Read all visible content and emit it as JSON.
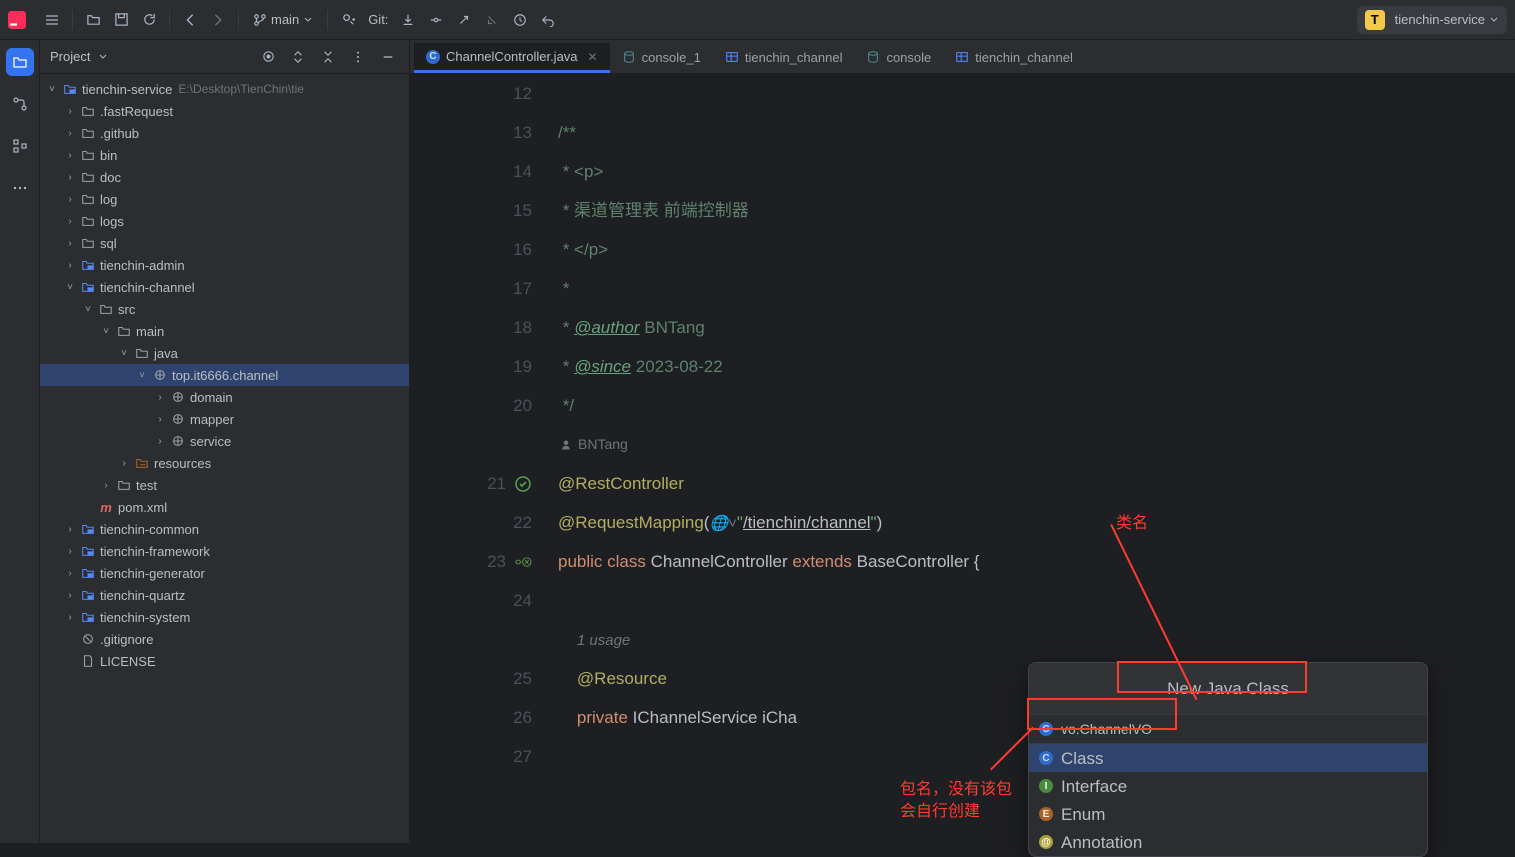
{
  "toolbar": {
    "branch": "main",
    "git_label": "Git:",
    "project": "tienchin-service",
    "project_badge": "T"
  },
  "project_panel": {
    "title": "Project",
    "root": {
      "name": "tienchin-service",
      "path": "E:\\Desktop\\TienChin\\tie"
    },
    "items": [
      {
        "indent": 1,
        "chev": ">",
        "type": "folder",
        "name": ".fastRequest"
      },
      {
        "indent": 1,
        "chev": ">",
        "type": "folder",
        "name": ".github"
      },
      {
        "indent": 1,
        "chev": ">",
        "type": "folder",
        "name": "bin"
      },
      {
        "indent": 1,
        "chev": ">",
        "type": "folder",
        "name": "doc"
      },
      {
        "indent": 1,
        "chev": ">",
        "type": "folder",
        "name": "log"
      },
      {
        "indent": 1,
        "chev": ">",
        "type": "folder",
        "name": "logs"
      },
      {
        "indent": 1,
        "chev": ">",
        "type": "folder",
        "name": "sql"
      },
      {
        "indent": 1,
        "chev": ">",
        "type": "module",
        "name": "tienchin-admin"
      },
      {
        "indent": 1,
        "chev": "v",
        "type": "module",
        "name": "tienchin-channel"
      },
      {
        "indent": 2,
        "chev": "v",
        "type": "folder",
        "name": "src"
      },
      {
        "indent": 3,
        "chev": "v",
        "type": "folder",
        "name": "main"
      },
      {
        "indent": 4,
        "chev": "v",
        "type": "folder",
        "name": "java"
      },
      {
        "indent": 5,
        "chev": "v",
        "type": "package",
        "name": "top.it6666.channel",
        "sel": true
      },
      {
        "indent": 6,
        "chev": ">",
        "type": "package",
        "name": "domain"
      },
      {
        "indent": 6,
        "chev": ">",
        "type": "package",
        "name": "mapper"
      },
      {
        "indent": 6,
        "chev": ">",
        "type": "package",
        "name": "service"
      },
      {
        "indent": 4,
        "chev": ">",
        "type": "resources",
        "name": "resources"
      },
      {
        "indent": 3,
        "chev": ">",
        "type": "folder",
        "name": "test"
      },
      {
        "indent": 2,
        "chev": "",
        "type": "maven",
        "name": "pom.xml"
      },
      {
        "indent": 1,
        "chev": ">",
        "type": "module",
        "name": "tienchin-common"
      },
      {
        "indent": 1,
        "chev": ">",
        "type": "module",
        "name": "tienchin-framework"
      },
      {
        "indent": 1,
        "chev": ">",
        "type": "module",
        "name": "tienchin-generator"
      },
      {
        "indent": 1,
        "chev": ">",
        "type": "module",
        "name": "tienchin-quartz"
      },
      {
        "indent": 1,
        "chev": ">",
        "type": "module",
        "name": "tienchin-system"
      },
      {
        "indent": 1,
        "chev": "",
        "type": "gitignore",
        "name": ".gitignore"
      },
      {
        "indent": 1,
        "chev": "",
        "type": "file",
        "name": "LICENSE"
      }
    ]
  },
  "tabs": [
    {
      "icon": "class",
      "label": "ChannelController.java",
      "active": true,
      "closable": true
    },
    {
      "icon": "db",
      "label": "console_1"
    },
    {
      "icon": "table",
      "label": "tienchin_channel"
    },
    {
      "icon": "db",
      "label": "console"
    },
    {
      "icon": "table",
      "label": "tienchin_channel"
    }
  ],
  "code": {
    "lines": [
      {
        "n": "12",
        "html": ""
      },
      {
        "n": "13",
        "html": "<span class='c-doc'>/**</span>"
      },
      {
        "n": "14",
        "html": "<span class='c-doc'> * &lt;p&gt;</span>"
      },
      {
        "n": "15",
        "html": "<span class='c-doc'> * 渠道管理表 前端控制器</span>"
      },
      {
        "n": "16",
        "html": "<span class='c-doc'> * &lt;/p&gt;</span>"
      },
      {
        "n": "17",
        "html": "<span class='c-doc'> *</span>"
      },
      {
        "n": "18",
        "html": "<span class='c-doc'> * </span><span class='c-tag'>@author</span><span class='c-doc'> BNTang</span>"
      },
      {
        "n": "19",
        "html": "<span class='c-doc'> * </span><span class='c-tag'>@since</span><span class='c-doc'> 2023-08-22</span>"
      },
      {
        "n": "20",
        "html": "<span class='c-doc'> */</span>"
      },
      {
        "n": "",
        "author": "BNTang"
      },
      {
        "n": "21",
        "mark": "green-check",
        "html": "<span class='c-ann'>@RestController</span>"
      },
      {
        "n": "22",
        "html": "<span class='c-ann'>@RequestMapping</span>(<span class='c-hint'>🌐˅</span><span class='c-str'>\"</span><span class='c-url'>/tienchin/channel</span><span class='c-str'>\"</span>)"
      },
      {
        "n": "23",
        "mark": "route",
        "html": "<span class='c-key'>public class </span><span class='c-cls'>ChannelController </span><span class='c-key'>extends </span><span class='c-cls'>BaseController {</span>"
      },
      {
        "n": "24",
        "html": ""
      },
      {
        "n": "",
        "usage": "1 usage"
      },
      {
        "n": "25",
        "html": "    <span class='c-ann'>@Resource</span>"
      },
      {
        "n": "26",
        "html": "    <span class='c-key'>private </span><span class='c-cls'>IChannelService iCha</span>"
      },
      {
        "n": "27",
        "html": ""
      }
    ]
  },
  "popup": {
    "title": "New Java Class",
    "input": "vo.ChannelVO",
    "options": [
      {
        "icon": "c",
        "label": "Class",
        "sel": true
      },
      {
        "icon": "i",
        "label": "Interface"
      },
      {
        "icon": "e",
        "label": "Enum"
      },
      {
        "icon": "a",
        "label": "Annotation"
      }
    ]
  },
  "annotations": {
    "label_classname": "类名",
    "label_package": "包名，没有该包",
    "label_package2": "会自行创建"
  }
}
